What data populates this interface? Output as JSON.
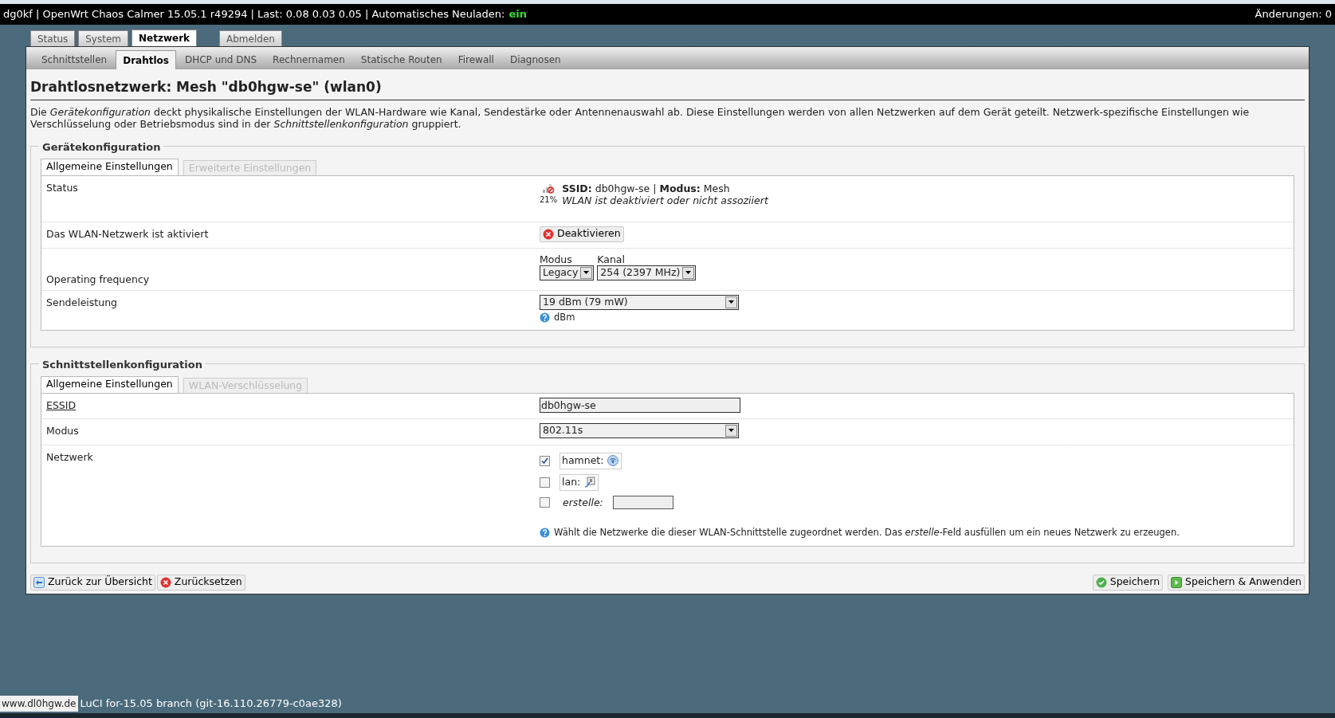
{
  "header": {
    "info": "dg0kf | OpenWrt Chaos Calmer 15.05.1 r49294 | Last: 0.08 0.03 0.05 | Automatisches Neuladen:",
    "autoreload": "ein",
    "changes": "Änderungen: 0"
  },
  "main_tabs": [
    {
      "label": "Status",
      "selected": false,
      "kind": "menu"
    },
    {
      "label": "System",
      "selected": false,
      "kind": "menu"
    },
    {
      "label": "Netzwerk",
      "selected": true,
      "kind": "menu"
    },
    {
      "label": "Abmelden",
      "selected": false,
      "kind": "logout"
    }
  ],
  "sub_tabs": [
    {
      "label": "Schnittstellen",
      "selected": false
    },
    {
      "label": "Drahtlos",
      "selected": true
    },
    {
      "label": "DHCP und DNS",
      "selected": false
    },
    {
      "label": "Rechnernamen",
      "selected": false
    },
    {
      "label": "Statische Routen",
      "selected": false
    },
    {
      "label": "Firewall",
      "selected": false
    },
    {
      "label": "Diagnosen",
      "selected": false
    }
  ],
  "title": "Drahtlosnetzwerk: Mesh \"db0hgw-se\" (wlan0)",
  "description": "Die *Gerätekonfiguration* deckt physikalische Einstellungen der WLAN-Hardware wie Kanal, Sendestärke oder Antennenauswahl ab. Diese Einstellungen werden von allen Netzwerken auf dem Gerät geteilt. Netzwerk-spezifische Einstellungen wie Verschlüsselung oder Betriebsmodus sind in der *Schnittstellenkonfiguration* gruppiert.",
  "sections": [
    {
      "legend": "Gerätekonfiguration",
      "tabs": [
        {
          "label": "Allgemeine Einstellungen",
          "selected": true
        },
        {
          "label": "Erweiterte Einstellungen",
          "selected": false
        }
      ],
      "rows": [
        {
          "kind": "status",
          "label": "Status",
          "signal": "21%",
          "summary": "**SSID:** db0hgw-se | **Modus:** Mesh",
          "note": "WLAN ist deaktiviert oder nicht assoziiert"
        },
        {
          "kind": "button",
          "label": "Das WLAN-Netzwerk ist aktiviert",
          "button": "Deaktivieren"
        },
        {
          "kind": "selects",
          "label": "Operating frequency",
          "fields": [
            {
              "label": "Modus",
              "value": "Legacy"
            },
            {
              "label": "Kanal",
              "value": "254 (2397 MHz)"
            }
          ]
        },
        {
          "kind": "select",
          "label": "Sendeleistung",
          "value": "19 dBm (79 mW)",
          "help": "dBm"
        }
      ]
    },
    {
      "legend": "Schnittstellenkonfiguration",
      "tabs": [
        {
          "label": "Allgemeine Einstellungen",
          "selected": true
        },
        {
          "label": "WLAN-Verschlüsselung",
          "selected": false
        }
      ],
      "rows": [
        {
          "kind": "text",
          "label": "ESSID",
          "value": "db0hgw-se"
        },
        {
          "kind": "select",
          "label": "Modus",
          "value": "802.11s"
        },
        {
          "kind": "networks",
          "label": "Netzwerk",
          "options": [
            {
              "kind": "network",
              "label": "hamnet:",
              "checked": true
            },
            {
              "kind": "lan",
              "label": "lan:",
              "checked": false
            },
            {
              "kind": "create",
              "label": "erstelle:",
              "checked": false
            }
          ],
          "help": "Wählt die Netzwerke die dieser WLAN-Schnittstelle zugeordnet werden. Das *erstelle*-Feld ausfüllen um ein neues Netzwerk zu erzeugen."
        }
      ]
    }
  ],
  "left_buttons": [
    {
      "kind": "back",
      "label": "Zurück zur Übersicht"
    },
    {
      "kind": "reset",
      "label": "Zurücksetzen"
    }
  ],
  "right_buttons": [
    {
      "kind": "save",
      "label": "Speichern"
    },
    {
      "kind": "apply",
      "label": "Speichern & Anwenden"
    }
  ],
  "browser_status": "www.dl0hgw.de",
  "footer": "LuCI for-15.05 branch (git-16.110.26779-c0ae328)"
}
